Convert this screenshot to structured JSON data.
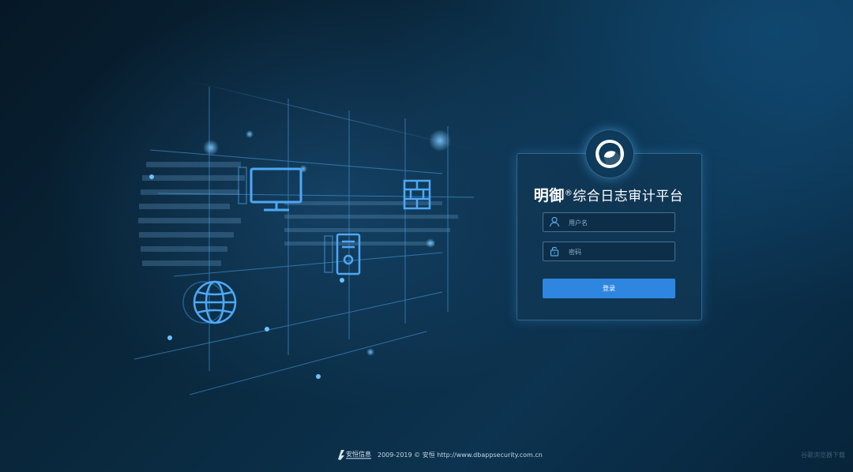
{
  "login": {
    "title_brand": "明御",
    "title_registered": "®",
    "title_rest": "综合日志审计平台",
    "username_placeholder": "用户名",
    "password_placeholder": "密码",
    "submit_label": "登录"
  },
  "footer": {
    "company_logo_text": "安恒信息",
    "copyright": "2009-2019 © 安恒 http://www.dbappsecurity.com.cn",
    "browser_download": "谷歌浏览器下载"
  },
  "colors": {
    "accent": "#2f86e0",
    "icon_blue": "#4ea8f5"
  }
}
